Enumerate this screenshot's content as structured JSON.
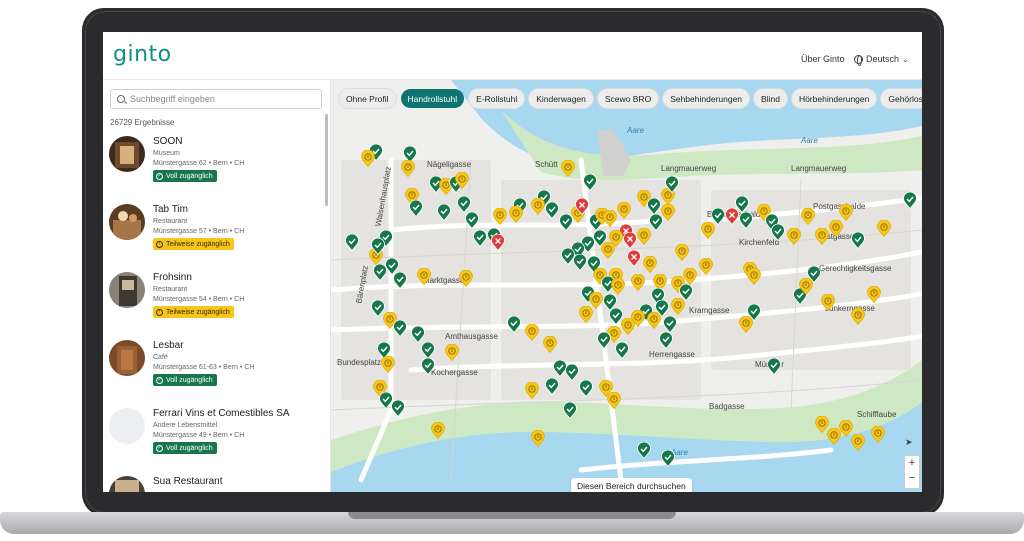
{
  "header": {
    "logo": "ginto",
    "about": "Über Ginto",
    "language": "Deutsch"
  },
  "sidebar": {
    "search_placeholder": "Suchbegriff eingeben",
    "result_count": "26729 Ergebnisse",
    "results": [
      {
        "name": "SOON",
        "type": "Museum",
        "address": "Münstergasse 62 • Bern • CH",
        "badge": "Voll zugänglich",
        "level": "full"
      },
      {
        "name": "Tab Tim",
        "type": "Restaurant",
        "address": "Münstergasse 57 • Bern • CH",
        "badge": "Teilweise zugänglich",
        "level": "partial"
      },
      {
        "name": "Frohsinn",
        "type": "Restaurant",
        "address": "Münstergasse 54 • Bern • CH",
        "badge": "Teilweise zugänglich",
        "level": "partial"
      },
      {
        "name": "Lesbar",
        "type": "Café",
        "address": "Münstergasse 61-63 • Bern • CH",
        "badge": "Voll zugänglich",
        "level": "full"
      },
      {
        "name": "Ferrari Vins et Comestibles SA",
        "type": "Andere Lebensmittel",
        "address": "Münstergasse 49 • Bern • CH",
        "badge": "Voll zugänglich",
        "level": "full"
      },
      {
        "name": "Sua Restaurant",
        "type": "",
        "address": "",
        "badge": "",
        "level": ""
      }
    ]
  },
  "filters": [
    "Ohne Profil",
    "Handrollstuhl",
    "E-Rollstuhl",
    "Kinderwagen",
    "Scewo BRO",
    "Sehbehinderungen",
    "Blind",
    "Hörbehinderungen",
    "Gehörlos"
  ],
  "active_filter": "Handrollstuhl",
  "map": {
    "street_labels": [
      "Nägeligasse",
      "Schütt",
      "Langmauerweg",
      "Langmauerweg",
      "Brunngasshalde",
      "Postgasshalde",
      "Postgasse",
      "Gerechtigkeitsgasse",
      "Junkerngasse",
      "Marktgasse",
      "Amthausgasse",
      "Kochergasse",
      "Herrengasse",
      "Badgasse",
      "Schifflaube",
      "Münster",
      "Bärenplatz",
      "Waisenhausplatz",
      "Kramgasse",
      "Aare",
      "Aare",
      "Aare",
      "Bundesplatz",
      "Kirchenfeld"
    ],
    "area_search_button": "Diesen Bereich durchsuchen",
    "zoom_in": "+",
    "zoom_out": "−",
    "locate_icon": "location-arrow-icon"
  },
  "colors": {
    "brand": "#0f8f8a",
    "active_filter": "#0f7470",
    "full_access": "#16774a",
    "partial_access": "#f7c51c",
    "no_access": "#e03b3b",
    "water": "#a7d8ef",
    "park": "#cfe8c4"
  }
}
